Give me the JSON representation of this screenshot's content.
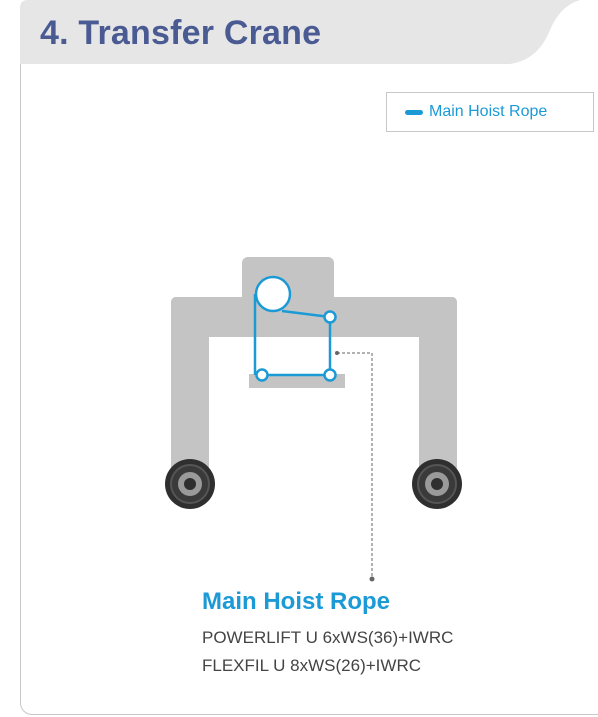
{
  "title": "4. Transfer Crane",
  "legend": {
    "label": "Main Hoist Rope",
    "color": "#1b9ad6"
  },
  "callout": {
    "title": "Main Hoist Rope",
    "specs": [
      "POWERLIFT U 6xWS(36)+IWRC",
      "FLEXFIL U 8xWS(26)+IWRC"
    ]
  },
  "colors": {
    "title": "#4a5a93",
    "header_bg": "#e6e6e6",
    "crane_body": "#c4c4c4",
    "rope": "#1b9ad6",
    "wheel": "#333333"
  }
}
